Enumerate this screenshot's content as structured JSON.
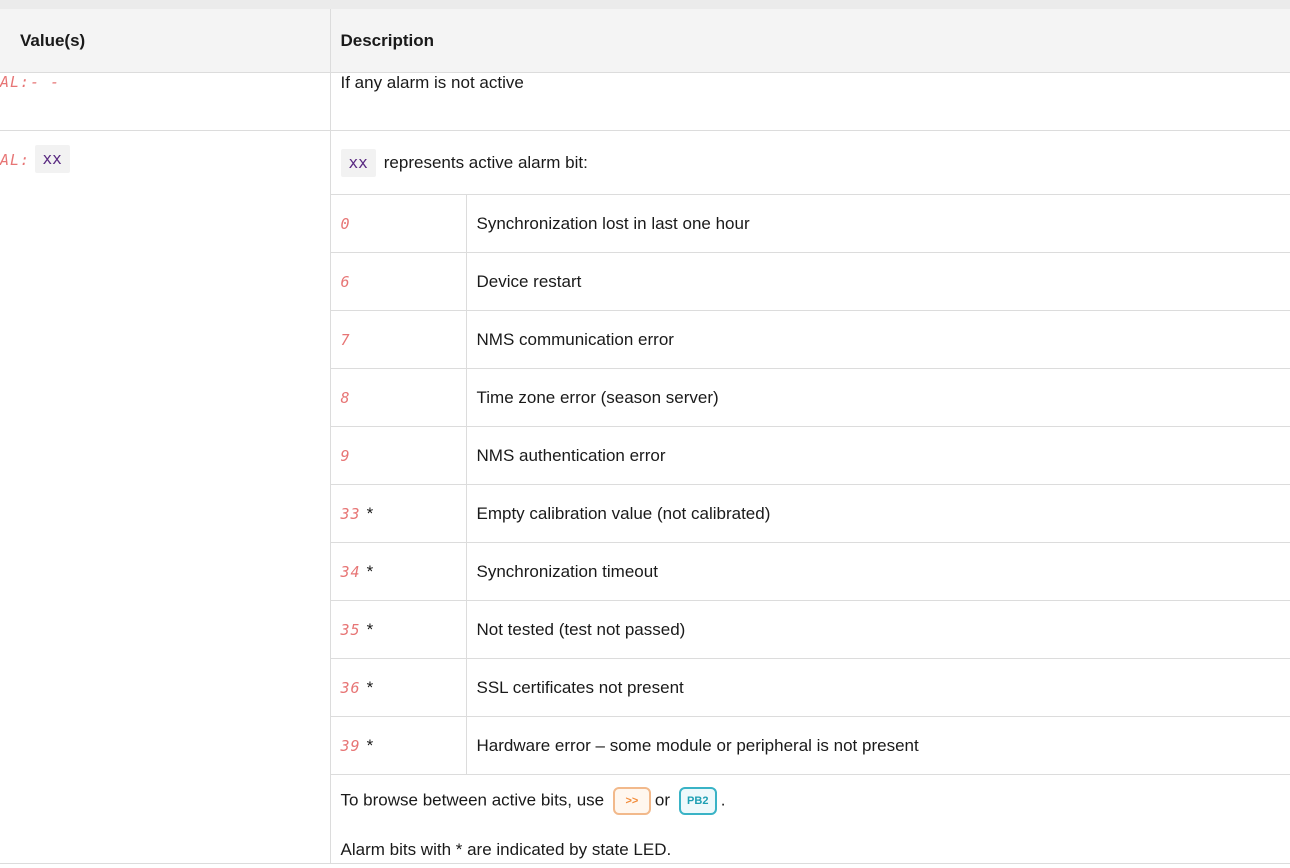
{
  "header": {
    "col_value": "Value(s)",
    "col_description": "Description"
  },
  "row_inactive": {
    "display": "AL:- -",
    "description": "If any alarm is not active"
  },
  "row_active": {
    "display_prefix": "AL:",
    "code": "xx",
    "intro_code": "xx",
    "intro_text": "represents active alarm bit:",
    "bits": [
      {
        "bit": "0",
        "star": "",
        "description": "Synchronization lost in last one hour"
      },
      {
        "bit": "6",
        "star": "",
        "description": "Device restart"
      },
      {
        "bit": "7",
        "star": "",
        "description": "NMS communication error"
      },
      {
        "bit": "8",
        "star": "",
        "description": "Time zone error (season server)"
      },
      {
        "bit": "9",
        "star": "",
        "description": "NMS authentication error"
      },
      {
        "bit": "33",
        "star": "*",
        "description": "Empty calibration value (not calibrated)"
      },
      {
        "bit": "34",
        "star": "*",
        "description": "Synchronization timeout"
      },
      {
        "bit": "35",
        "star": "*",
        "description": "Not tested (test not passed)"
      },
      {
        "bit": "36",
        "star": "*",
        "description": "SSL certificates not present"
      },
      {
        "bit": "39",
        "star": "*",
        "description": "Hardware error – some module or peripheral is not present"
      }
    ],
    "browse_text_before": "To browse between active bits, use",
    "browse_button_1": ">>",
    "browse_or": "or",
    "browse_button_2": "PB2",
    "browse_text_after": ".",
    "note": "Alarm bits with * are indicated by state LED."
  },
  "colors": {
    "lcd": "#e35d5d",
    "code": "#5a2a82",
    "button_orange": "#f28c3a",
    "button_teal": "#1d9fb3"
  }
}
